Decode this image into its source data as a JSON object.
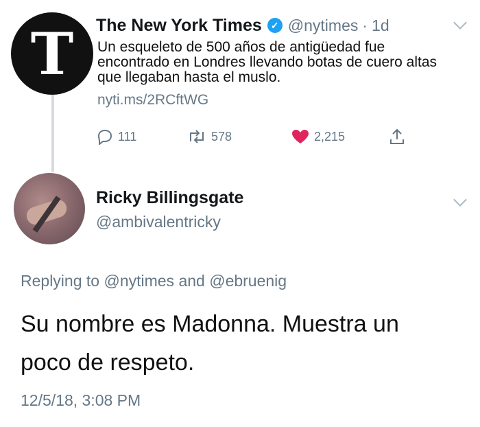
{
  "tweet": {
    "author_name": "The New York Times",
    "author_handle": "@nytimes",
    "separator": "·",
    "time": "1d",
    "avatar_letter": "T",
    "text": "Un esqueleto de 500 años de antigüedad fue encontrado en Londres llevando botas de cuero altas que llegaban hasta el muslo.",
    "link": "nyti.ms/2RCftWG",
    "replies": "111",
    "retweets": "578",
    "likes": "2,215"
  },
  "reply": {
    "author_name": "Ricky Billingsgate",
    "author_handle": "@ambivalentricky",
    "replying_label": "Replying to",
    "mention_1": "@nytimes",
    "and_label": "and",
    "mention_2": "@ebruenig",
    "text": "Su nombre es Madonna. Muestra un poco de respeto.",
    "timestamp": "12/5/18, 3:08 PM"
  },
  "colors": {
    "verified": "#1da1f2",
    "like": "#e0245e",
    "muted": "#657786"
  },
  "icons": [
    "verified-badge-icon",
    "chevron-down-icon",
    "reply-icon",
    "retweet-icon",
    "heart-icon",
    "share-icon"
  ]
}
